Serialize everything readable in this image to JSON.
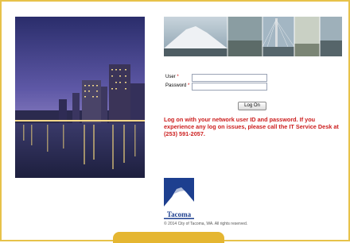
{
  "login": {
    "user_label": "User",
    "password_label": "Password",
    "required_marker": "*",
    "user_value": "",
    "password_value": "",
    "logon_button_label": "Log On"
  },
  "message": {
    "text": "Log on with your network user ID and password. If you experience any log on issues, please call the IT Service Desk at (253) 591-2057."
  },
  "logo": {
    "text": "Tacoma"
  },
  "footer": {
    "copyright": "© 2014 City of Tacoma, WA. All rights reserved."
  },
  "colors": {
    "frame": "#e7c24a",
    "message": "#cc1d1d",
    "logo_blue": "#1d3f8f",
    "bottom_tab": "#e5b631"
  }
}
